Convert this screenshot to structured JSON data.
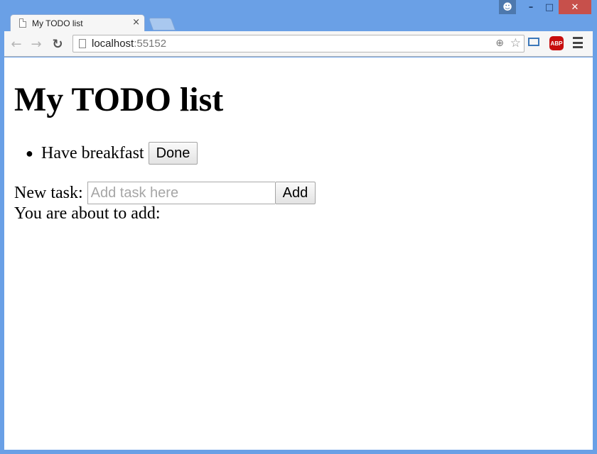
{
  "browser": {
    "tab_title": "My TODO list",
    "tab_close_glyph": "×",
    "url_host": "localhost",
    "url_port": ":55152",
    "abp_label": "ABP"
  },
  "page": {
    "heading": "My TODO list",
    "todos": [
      {
        "text": "Have breakfast",
        "button": "Done"
      }
    ],
    "new_task_label": "New task:",
    "task_input_placeholder": "Add task here",
    "task_input_value": "",
    "add_button": "Add",
    "about_text": "You are about to add:"
  },
  "icons": {
    "back": "back-arrow-icon",
    "forward": "forward-arrow-icon",
    "reload": "reload-icon",
    "zoom": "zoom-icon",
    "star": "star-icon",
    "cast": "cast-icon",
    "menu": "menu-icon"
  },
  "colors": {
    "window_frame": "#6aa0e6",
    "close_button": "#c7504b",
    "abp_red": "#c70d0d"
  }
}
